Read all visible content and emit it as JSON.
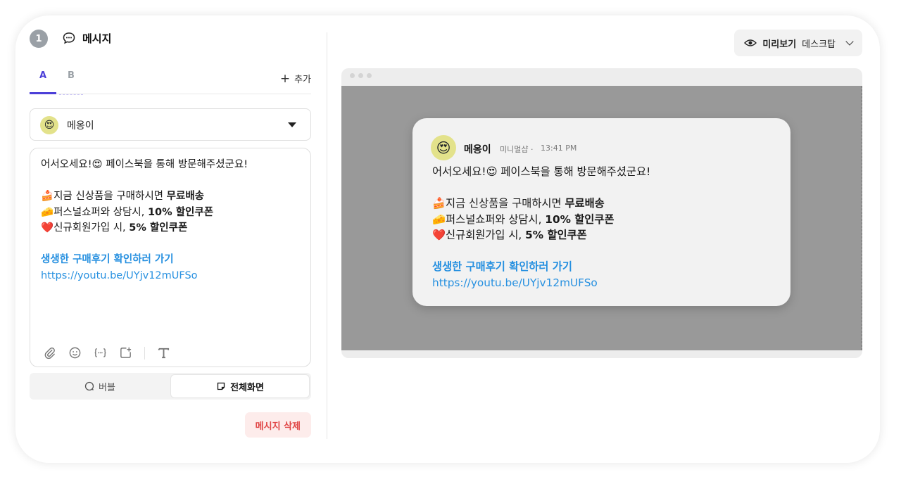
{
  "left": {
    "step_number": "1",
    "title": "메시지",
    "tabs": [
      {
        "label": "A"
      },
      {
        "label": "B"
      }
    ],
    "add_label": "추가",
    "sender": {
      "avatar": "😍",
      "name": "메옹이"
    },
    "message": {
      "greeting": "어서오세요!",
      "greeting_emoji": "😍",
      "greeting_rest": " 페이스북을 통해 방문해주셨군요!",
      "line1_emoji": "🍰",
      "line1_text": "지금 신상품을 구매하시면 ",
      "line1_bold": "무료배송",
      "line2_emoji": "🧀",
      "line2_text": "퍼스널쇼퍼와 상담시, ",
      "line2_bold": "10% 할인쿠폰",
      "line3_emoji": "❤️",
      "line3_text": "신규회원가입 시, ",
      "line3_bold": "5% 할인쿠폰",
      "link_title": "생생한 구매후기 확인하러 가기",
      "link_url": "https://youtu.be/UYjv12mUFSo"
    },
    "toolbar_icons": [
      "paperclip-icon",
      "smiley-icon",
      "variable-icon",
      "add-image-icon",
      "text-format-icon"
    ],
    "mode": {
      "bubble_label": "버블",
      "full_label": "전체화면",
      "selected": "전체화면"
    },
    "delete_label": "메시지 삭제"
  },
  "right": {
    "preview_label": "미리보기",
    "preview_mode": "데스크탑",
    "bubble": {
      "avatar": "😍",
      "name": "메옹이",
      "shop": "미니멀샵",
      "separator": "·",
      "time": "13:41 PM"
    }
  },
  "colors": {
    "accent": "#4b3fd8",
    "link": "#2690e0",
    "danger": "#e04545",
    "danger_bg": "#fdeceb"
  }
}
